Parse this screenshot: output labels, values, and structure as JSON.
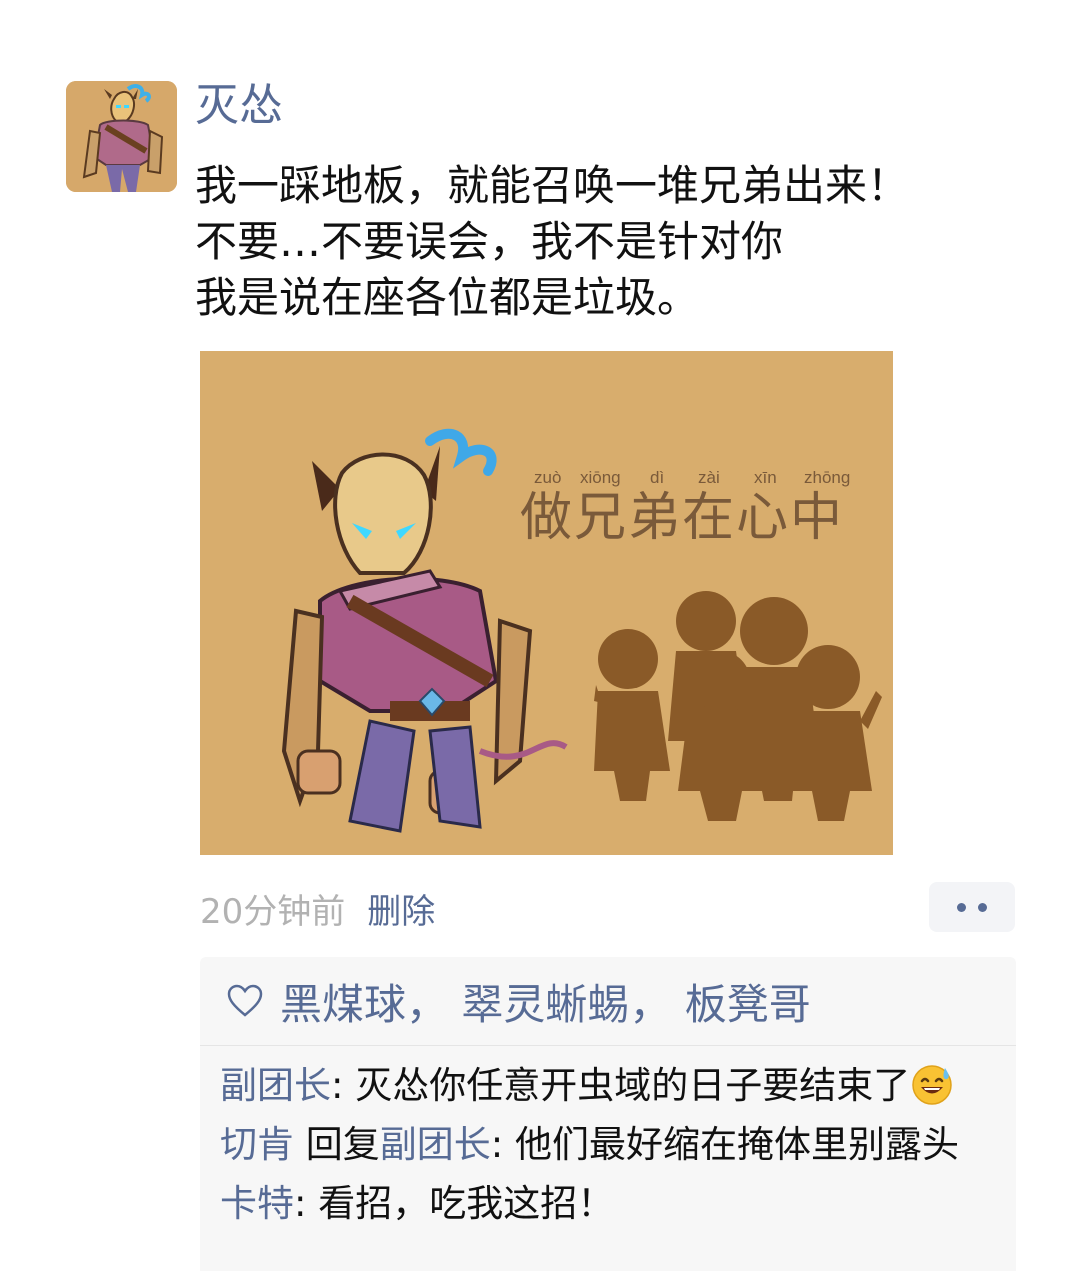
{
  "post": {
    "username": "灭怂",
    "text_lines": [
      "我一踩地板，就能召唤一堆兄弟出来！",
      "不要…不要误会，我不是针对你",
      "我是说在座各位都是垃圾。"
    ],
    "image": {
      "pinyin": [
        "zuò",
        "xiōng",
        "dì",
        "zài",
        "xīn",
        "zhōng"
      ],
      "caption": "做兄弟在心中",
      "colors": {
        "background": "#d8ad6d",
        "silhouette": "#8a5a28",
        "text": "#7a5a3a"
      }
    },
    "time": "20分钟前",
    "delete_label": "删除"
  },
  "likes": {
    "names": "黑煤球， 翠灵蜥蜴， 板凳哥"
  },
  "comments": [
    {
      "name": "副团长",
      "sep": ": ",
      "text": "灭怂你任意开虫域的日子要结束了",
      "emoji": "sweat-smile-emoji"
    },
    {
      "name": "切肯",
      "reply_word": "回复",
      "reply_to": "副团长",
      "sep": ": ",
      "text": "他们最好缩在掩体里别露头"
    },
    {
      "name": "卡特",
      "sep": ": ",
      "text": "看招，吃我这招！"
    }
  ],
  "colors": {
    "link": "#576b95",
    "text": "#111111",
    "meta": "#b2b2b2",
    "panel": "#f7f7f7"
  }
}
